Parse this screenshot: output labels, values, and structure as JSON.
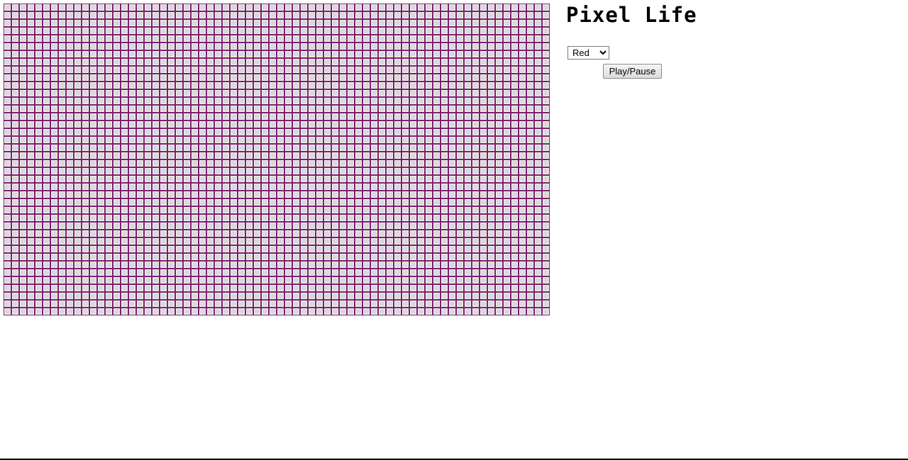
{
  "title": "Pixel Life",
  "controls": {
    "color_options": [
      "Red"
    ],
    "selected_color": "Red",
    "play_pause_label": "Play/Pause"
  },
  "grid": {
    "columns": 70,
    "rows": 40,
    "cell_border_color": "#7a1f6e",
    "cell_fill_color": "#d9d9d9"
  }
}
